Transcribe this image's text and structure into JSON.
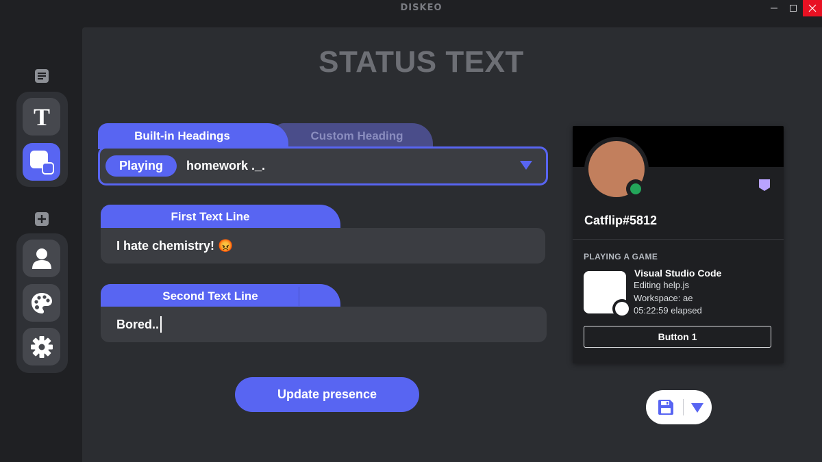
{
  "window": {
    "app_title": "DISKEO",
    "minimize_icon": "minimize-icon",
    "maximize_icon": "maximize-icon",
    "close_icon": "close-icon"
  },
  "sidebar": {
    "top_icon": "document-icon",
    "items_top": [
      {
        "icon": "text-icon",
        "label": "T",
        "active": false
      },
      {
        "icon": "activity-image-icon",
        "active": true
      }
    ],
    "add_icon": "plus-icon",
    "items_bottom": [
      {
        "icon": "user-icon"
      },
      {
        "icon": "palette-icon"
      },
      {
        "icon": "gear-icon"
      }
    ]
  },
  "page": {
    "title": "STATUS TEXT"
  },
  "heading": {
    "tabs": [
      {
        "label": "Built-in Headings",
        "active": true
      },
      {
        "label": "Custom Heading",
        "active": false
      }
    ],
    "selected_pill": "Playing",
    "value": "homework ._."
  },
  "first_line": {
    "label": "First Text Line",
    "value": "I hate chemistry! 😡"
  },
  "second_line": {
    "label": "Second Text Line",
    "value": "Bored.."
  },
  "update_button": "Update presence",
  "profile": {
    "username": "Catflip#5812",
    "status": "online",
    "status_color": "#23a55a",
    "avatar_color": "#c27f5d",
    "activity_header": "PLAYING A GAME",
    "activity_name": "Visual Studio Code",
    "details": "Editing help.js",
    "state": "Workspace: ae",
    "elapsed": "05:22:59 elapsed",
    "button_label": "Button 1"
  },
  "save": {
    "icon": "save-icon",
    "dropdown_icon": "chevron-down-icon"
  },
  "colors": {
    "accent": "#5865f2",
    "background": "#2b2d31",
    "sidebar": "#1f2023"
  }
}
